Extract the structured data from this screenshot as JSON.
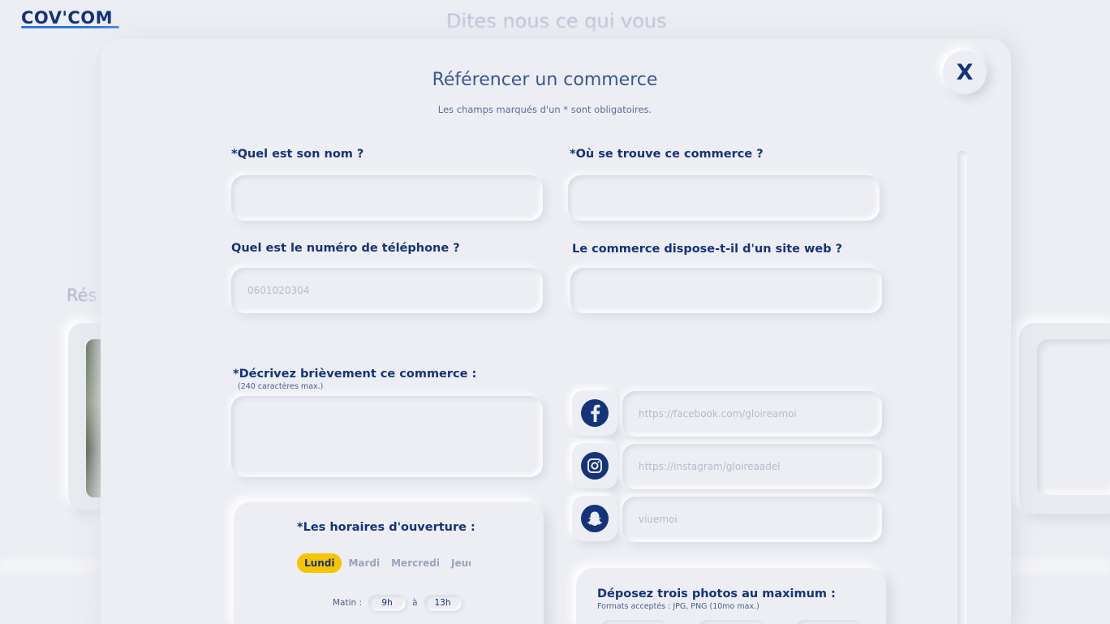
{
  "background": {
    "logo": "COV'COM",
    "headline": "Dites nous ce qui vous",
    "section_fragment": "Rés"
  },
  "modal": {
    "title": "Référencer un commerce",
    "subtitle": "Les champs marqués d'un * sont obligatoires.",
    "close_label": "X",
    "fields": {
      "name": {
        "label": "*Quel est son nom ?",
        "value": "",
        "placeholder": ""
      },
      "location": {
        "label": "*Où se trouve ce commerce ?",
        "value": "",
        "placeholder": ""
      },
      "phone": {
        "label": "Quel est le numéro de téléphone ?",
        "value": "",
        "placeholder": "0601020304"
      },
      "website": {
        "label": "Le commerce dispose-t-il d'un site web ?",
        "value": "",
        "placeholder": ""
      },
      "description": {
        "label": "*Décrivez brièvement ce commerce :",
        "hint": "(240 caractères max.)",
        "value": ""
      }
    },
    "socials": [
      {
        "icon": "facebook-icon",
        "placeholder": "https://facebook.com/gloireamoi"
      },
      {
        "icon": "instagram-icon",
        "placeholder": "https://instagram/gloireaadel"
      },
      {
        "icon": "snapchat-icon",
        "placeholder": "viuemoi"
      }
    ],
    "hours": {
      "label": "*Les horaires d'ouverture :",
      "days": [
        "Lundi",
        "Mardi",
        "Mercredi",
        "Jeudi"
      ],
      "selected_day": "Lundi",
      "morning_label": "Matin :",
      "from": "9h",
      "separator": "à",
      "to": "13h"
    },
    "photos": {
      "label": "Déposez trois photos au maximum :",
      "hint": "Formats acceptés : JPG, PNG (10mo max.)"
    }
  },
  "colors": {
    "primary": "#14337a",
    "accent": "#f6c400",
    "background": "#eceef3",
    "logo_underline": "#2f78d6"
  }
}
